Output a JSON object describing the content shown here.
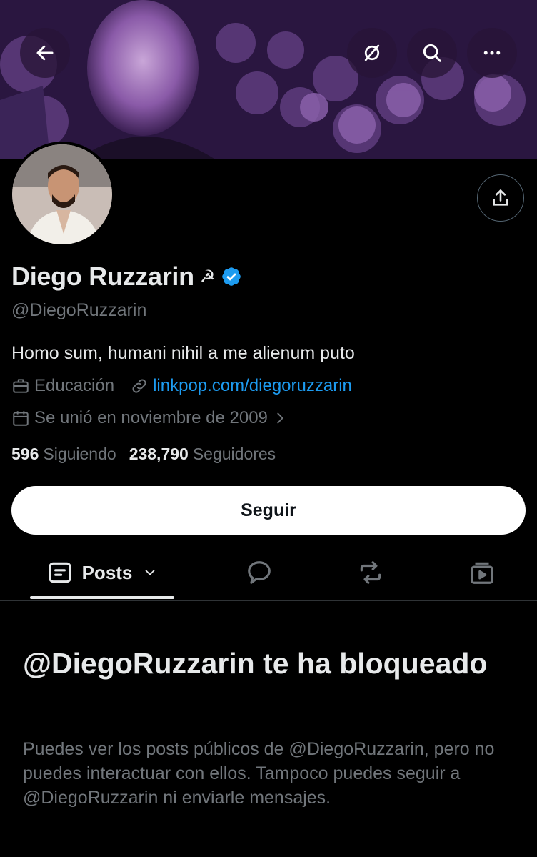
{
  "profile": {
    "name": "Diego Ruzzarin",
    "name_emoji": "☭",
    "handle": "@DiegoRuzzarin",
    "bio": "Homo sum, humani nihil a me alienum puto",
    "category": "Educación",
    "link": "linkpop.com/diegoruzzarin",
    "joined": "Se unió en noviembre de 2009",
    "following_count": "596",
    "following_label": "Siguiendo",
    "followers_count": "238,790",
    "followers_label": "Seguidores"
  },
  "actions": {
    "follow_label": "Seguir"
  },
  "tabs": {
    "posts_label": "Posts"
  },
  "blocked": {
    "title": "@DiegoRuzzarin te ha bloqueado",
    "description": "Puedes ver los posts públicos de @DiegoRuzzarin, pero no puedes interactuar con ellos. Tampoco puedes seguir a @DiegoRuzzarin ni enviarle mensajes."
  },
  "icons": {
    "back": "arrow-left-icon",
    "grok": "slash-circle-icon",
    "search": "search-icon",
    "more": "more-dots-icon",
    "share": "share-icon",
    "verified": "verified-badge-icon",
    "category": "briefcase-icon",
    "link": "link-icon",
    "calendar": "calendar-icon",
    "posts": "posts-icon",
    "replies": "reply-bubble-icon",
    "reposts": "repost-icon",
    "media": "media-icon"
  },
  "colors": {
    "accent": "#1d9bf0",
    "background": "#000000",
    "muted": "#71767b",
    "text": "#e7e9ea"
  }
}
